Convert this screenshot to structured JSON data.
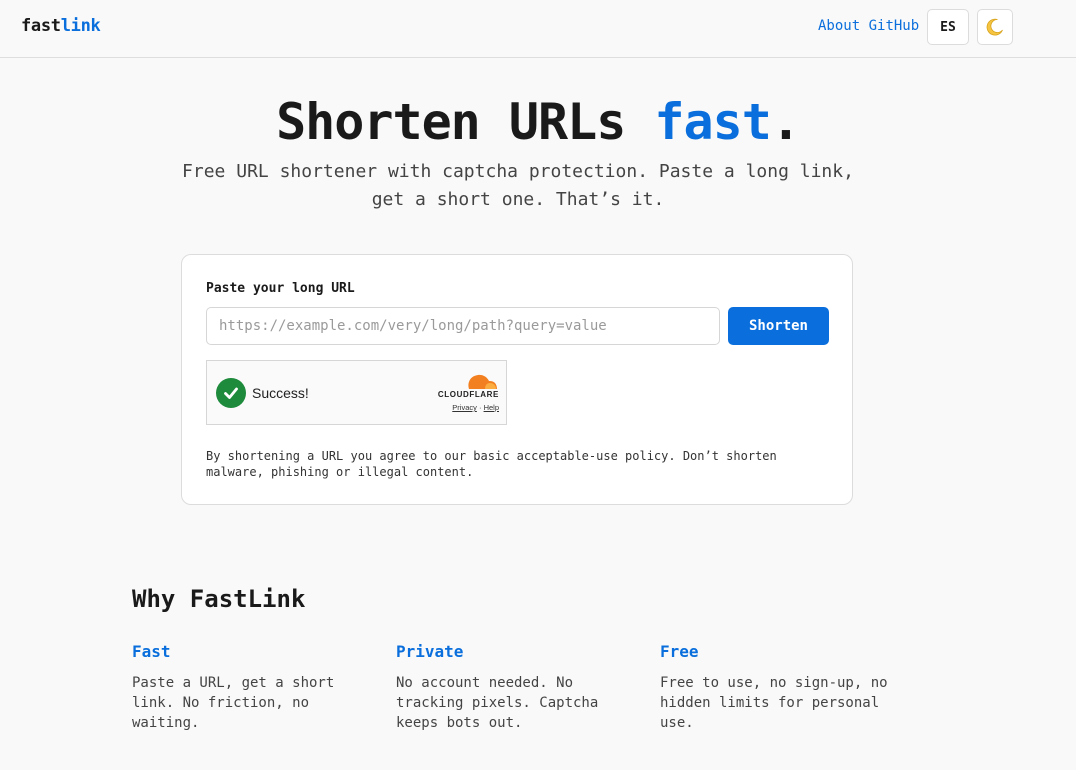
{
  "header": {
    "logo_part_a": "fast",
    "logo_part_b": "link",
    "nav_about": "About",
    "nav_github": "GitHub",
    "lang_button": "ES",
    "theme_icon": "moon-icon"
  },
  "hero": {
    "title_part_a": "Shorten URLs ",
    "title_accent": "fast",
    "title_end": ".",
    "subtitle": "Free URL shortener with captcha protection. Paste a long link, get a short one. That’s it."
  },
  "form": {
    "label": "Paste your long URL",
    "input_value": "",
    "input_placeholder": "https://example.com/very/long/path?query=value",
    "submit_label": "Shorten",
    "captcha": {
      "status": "Success!",
      "brand": "CLOUDFLARE",
      "privacy_link": "Privacy",
      "separator": "·",
      "help_link": "Help"
    },
    "policy_text": "By shortening a URL you agree to our basic acceptable-use policy. Don’t shorten malware, phishing or illegal content."
  },
  "why": {
    "title": "Why FastLink",
    "features": [
      {
        "title": "Fast",
        "body": "Paste a URL, get a short link. No friction, no waiting."
      },
      {
        "title": "Private",
        "body": "No account needed. No tracking pixels. Captcha keeps bots out."
      },
      {
        "title": "Free",
        "body": "Free to use, no sign-up, no hidden limits for personal use."
      }
    ]
  },
  "colors": {
    "accent": "#0a6fdc",
    "success": "#1e8a3c",
    "cloudflare_orange": "#f38020"
  }
}
